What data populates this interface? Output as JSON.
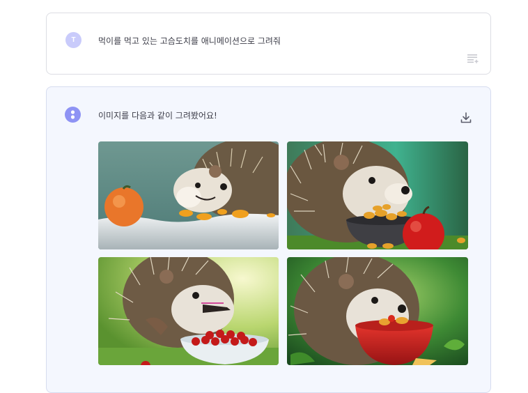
{
  "user_message": {
    "avatar_initial": "T",
    "text": "먹이를 먹고 있는 고슴도치를 애니메이션으로 그려줘",
    "icon": "list-add-icon"
  },
  "ai_message": {
    "avatar_icon": "bot-icon",
    "text": "이미지를 다음과 같이 그려봤어요!",
    "download_icon": "download-icon",
    "images": [
      {
        "subject": "hedgehog eating orange snacks on white surface",
        "icon": "image"
      },
      {
        "subject": "hedgehog with bowl of nuts and red apple",
        "icon": "image"
      },
      {
        "subject": "hedgehog eating red berries from white bowl",
        "icon": "image"
      },
      {
        "subject": "hedgehog eating from red bowl in green forest",
        "icon": "image"
      }
    ]
  },
  "colors": {
    "user_avatar": "#c9cbfb",
    "ai_avatar": "#8e93f4",
    "ai_card_bg": "#f4f7fe",
    "border": "#dcdde3"
  }
}
